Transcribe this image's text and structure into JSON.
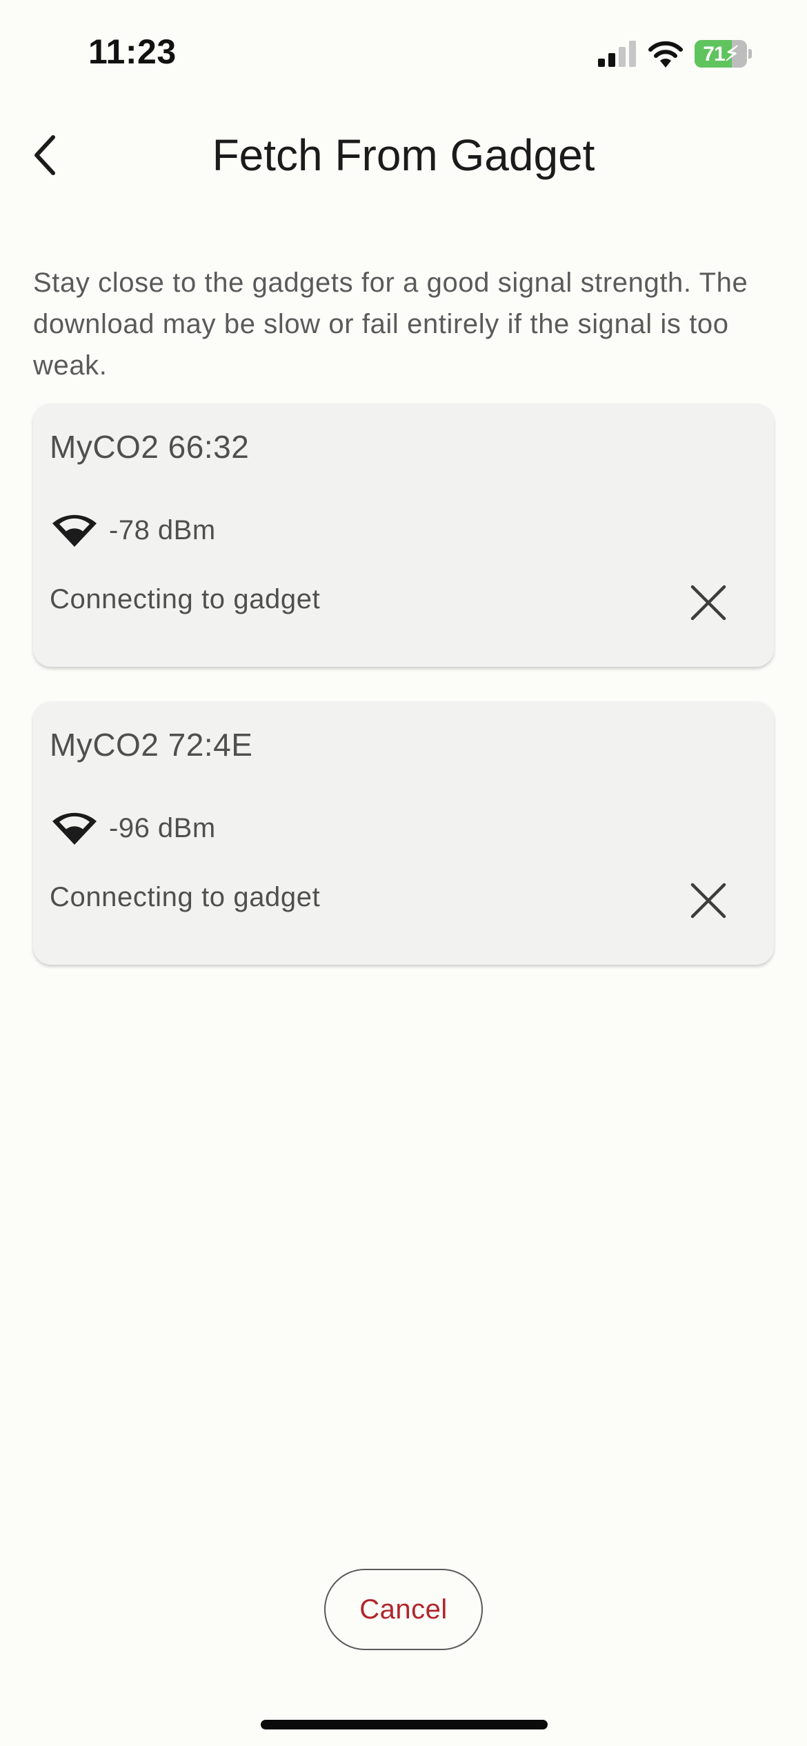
{
  "status_bar": {
    "time": "11:23",
    "battery_percent": "71",
    "battery_level": 0.71,
    "battery_charging": true,
    "cellular_bars": 2,
    "icons": [
      "cellular-signal-icon",
      "wifi-icon",
      "battery-charging-icon"
    ]
  },
  "nav": {
    "title": "Fetch From Gadget",
    "back_icon": "chevron-left-icon"
  },
  "intro": {
    "text": "Stay close to the gadgets for a good signal strength. The download may be slow or fail entirely if the signal is too weak."
  },
  "gadgets": [
    {
      "name": "MyCO2 66:32",
      "signal": "-78 dBm",
      "status": "Connecting to gadget",
      "icon": "wifi-signal-icon",
      "action_icon": "close-icon"
    },
    {
      "name": "MyCO2 72:4E",
      "signal": "-96 dBm",
      "status": "Connecting to gadget",
      "icon": "wifi-signal-icon",
      "action_icon": "close-icon"
    }
  ],
  "footer": {
    "cancel_label": "Cancel"
  },
  "colors": {
    "background": "#FCFCF9",
    "card_background": "#F2F3F0",
    "cancel_text": "#B0252A",
    "battery_green": "#5FC35E"
  }
}
